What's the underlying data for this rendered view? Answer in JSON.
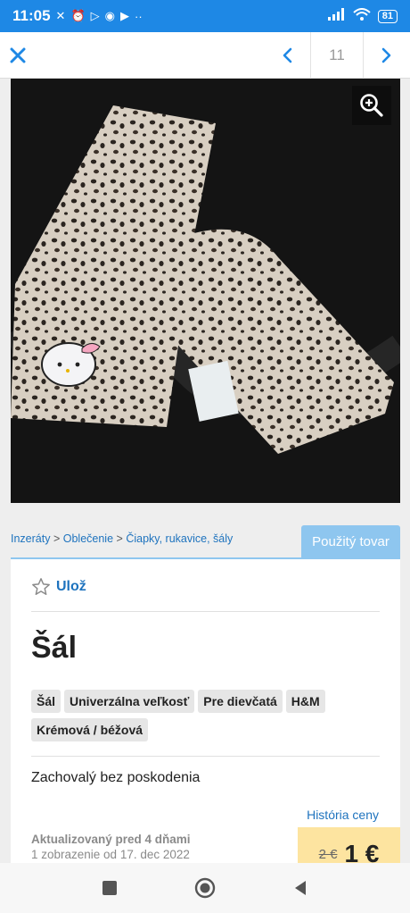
{
  "status": {
    "time": "11:05",
    "battery": "81"
  },
  "topbar": {
    "page_number": "11"
  },
  "breadcrumbs": [
    {
      "label": "Inzeráty"
    },
    {
      "label": "Oblečenie"
    },
    {
      "label": "Čiapky, rukavice, šály"
    }
  ],
  "breadcrumb_sep": ">",
  "condition": "Použitý tovar",
  "listing": {
    "save_label": "Ulož",
    "title": "Šál",
    "tags": [
      "Šál",
      "Univerzálna veľkosť",
      "Pre dievčatá",
      "H&M",
      "Krémová / béžová"
    ],
    "description": "Zachovalý bez poskodenia",
    "price_history_label": "História ceny",
    "updated": "Aktualizovaný pred 4 dňami",
    "views": "1 zobrazenie od 17. dec 2022",
    "old_price": "2 €",
    "price": "1 €"
  },
  "colors": {
    "brand_blue": "#1e88e5",
    "link_blue": "#1e73be",
    "condition_bg": "#8ec6ef",
    "price_bg": "#fde4a0"
  }
}
